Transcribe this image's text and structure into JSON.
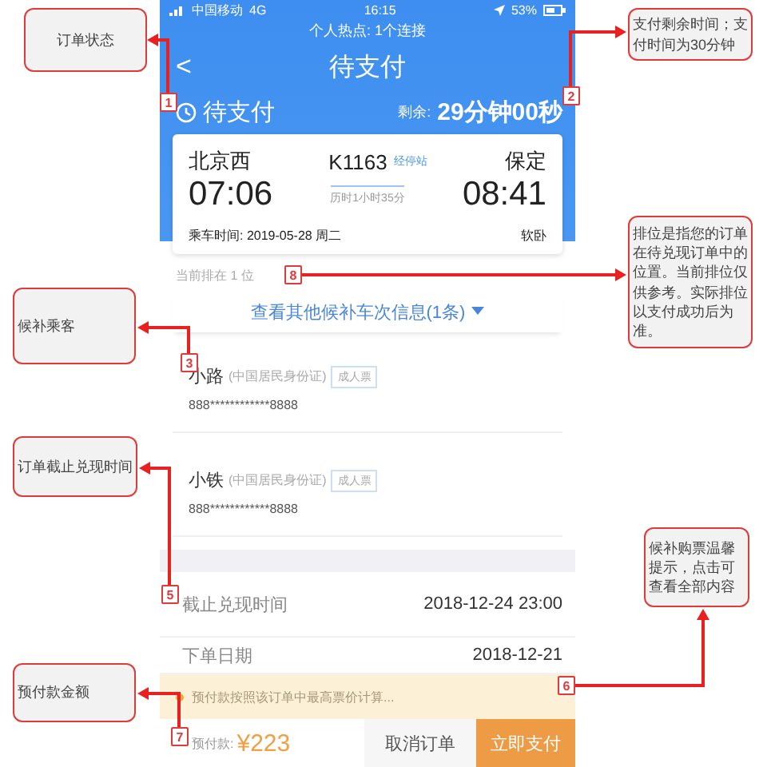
{
  "status_bar": {
    "carrier": "中国移动",
    "network": "4G",
    "time": "16:15",
    "battery": "53%",
    "hotspot": "个人热点: 1个连接"
  },
  "nav": {
    "back": "<",
    "title": "待支付"
  },
  "order_status": {
    "label": "待支付",
    "remaining_label": "剩余:",
    "remaining": "29分钟00秒"
  },
  "trip": {
    "from": "北京西",
    "train": "K1163",
    "stops_link": "经停站",
    "to": "保定",
    "depart": "07:06",
    "duration": "历时1小时35分",
    "arrive": "08:41",
    "date": "乘车时间: 2019-05-28 周二",
    "seat": "软卧"
  },
  "queue_position": "当前排在 1 位",
  "other_trains_link": "查看其他候补车次信息(1条)",
  "passengers": [
    {
      "name": "小路",
      "id_type": "(中国居民身份证)",
      "ticket_type": "成人票",
      "id_number": "888************8888"
    },
    {
      "name": "小铁",
      "id_type": "(中国居民身份证)",
      "ticket_type": "成人票",
      "id_number": "888************8888"
    }
  ],
  "details": [
    {
      "label": "截止兑现时间",
      "value": "2018-12-24 23:00"
    },
    {
      "label": "下单日期",
      "value": "2018-12-21"
    }
  ],
  "tip": "预付款按照该订单中最高票价计算...",
  "bottom_bar": {
    "amount_label": "预付款:",
    "amount": "¥223",
    "cancel": "取消订单",
    "pay": "立即支付"
  },
  "annotations": [
    {
      "number": "1",
      "text": "订单状态"
    },
    {
      "number": "3",
      "text": "候补乘客"
    },
    {
      "number": "5",
      "text": "订单截止兑现时间"
    },
    {
      "number": "7",
      "text": "预付款金额"
    },
    {
      "number": "2",
      "text": "支付剩余时间；支付时间为30分钟"
    },
    {
      "number": "8",
      "text": "排位是指您的订单在待兑现订单中的位置。当前排位仅供参考。实际排位以支付成功后为准。"
    },
    {
      "number": "6",
      "text": "候补购票温馨提示，点击可查看全部内容"
    }
  ]
}
